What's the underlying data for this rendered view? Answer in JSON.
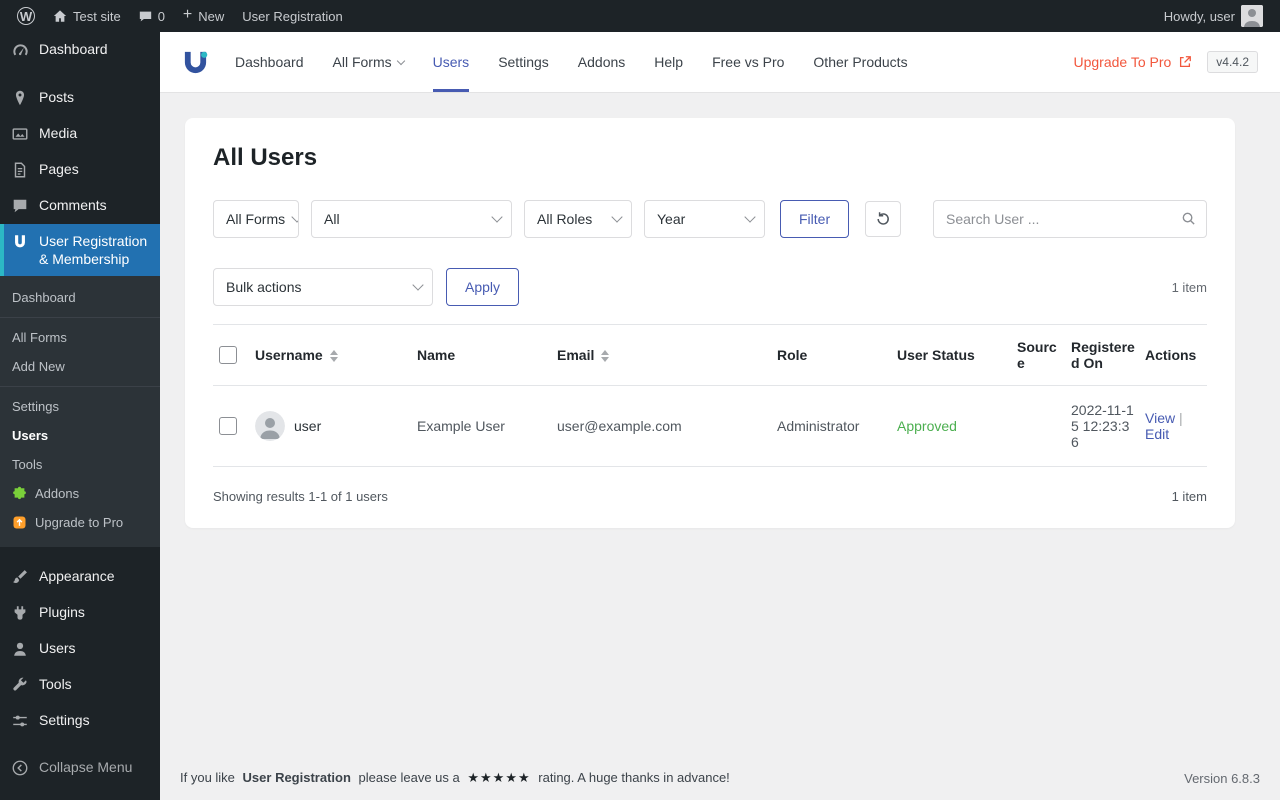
{
  "admin_bar": {
    "site_name": "Test site",
    "comments_count": "0",
    "new_label": "New",
    "plugin_label": "User Registration",
    "howdy": "Howdy, user"
  },
  "sidebar": {
    "top": [
      {
        "label": "Dashboard",
        "icon": "dashboard-icon"
      },
      {
        "label": "Posts",
        "icon": "pin-icon"
      },
      {
        "label": "Media",
        "icon": "media-icon"
      },
      {
        "label": "Pages",
        "icon": "pages-icon"
      },
      {
        "label": "Comments",
        "icon": "comments-icon"
      }
    ],
    "active_item": {
      "label": "User Registration & Membership",
      "icon": "user-registration-icon"
    },
    "submenu": [
      {
        "label": "Dashboard"
      },
      {
        "label": "All Forms"
      },
      {
        "label": "Add New"
      },
      {
        "label": "Settings"
      },
      {
        "label": "Users",
        "active": true
      },
      {
        "label": "Tools"
      },
      {
        "label": "Addons",
        "icon": "addons-icon"
      },
      {
        "label": "Upgrade to Pro",
        "icon": "upgrade-icon"
      }
    ],
    "bottom": [
      {
        "label": "Appearance",
        "icon": "appearance-icon"
      },
      {
        "label": "Plugins",
        "icon": "plugin-icon"
      },
      {
        "label": "Users",
        "icon": "users-icon"
      },
      {
        "label": "Tools",
        "icon": "tools-icon"
      },
      {
        "label": "Settings",
        "icon": "settings-icon"
      }
    ],
    "collapse": "Collapse Menu"
  },
  "nav": {
    "items": [
      {
        "label": "Dashboard"
      },
      {
        "label": "All Forms",
        "has_dropdown": true
      },
      {
        "label": "Users",
        "active": true
      },
      {
        "label": "Settings"
      },
      {
        "label": "Addons"
      },
      {
        "label": "Help"
      },
      {
        "label": "Free vs Pro"
      },
      {
        "label": "Other Products"
      }
    ],
    "upgrade_label": "Upgrade To Pro",
    "version_badge": "v4.4.2"
  },
  "content": {
    "title": "All Users",
    "filters": {
      "forms_select": "All Forms",
      "secondary_select": "All",
      "roles_select": "All Roles",
      "date_select": "Year",
      "filter_button": "Filter",
      "search_placeholder": "Search User ..."
    },
    "bulk": {
      "select_label": "Bulk actions",
      "apply_button": "Apply"
    },
    "item_count": "1 item",
    "table": {
      "headers": {
        "username": "Username",
        "name": "Name",
        "email": "Email",
        "role": "Role",
        "status": "User Status",
        "source": "Source",
        "registered": "Registered On",
        "actions": "Actions"
      },
      "row": {
        "username": "user",
        "name": "Example User",
        "email": "user@example.com",
        "role": "Administrator",
        "status": "Approved",
        "source": "",
        "registered": "2022-11-15 12:23:36",
        "action_view": "View",
        "action_separator": "|",
        "action_edit": "Edit"
      }
    },
    "results_text": "Showing results 1-1 of 1 users"
  },
  "footer": {
    "like_prefix": "If you like",
    "plugin_name": "User Registration",
    "like_middle": "please leave us a",
    "stars": "★★★★★",
    "like_suffix": "rating. A huge thanks in advance!",
    "version": "Version 6.8.3"
  },
  "colors": {
    "accent": "#475bb2",
    "upgrade": "#f2573d",
    "approved": "#4caf50"
  }
}
